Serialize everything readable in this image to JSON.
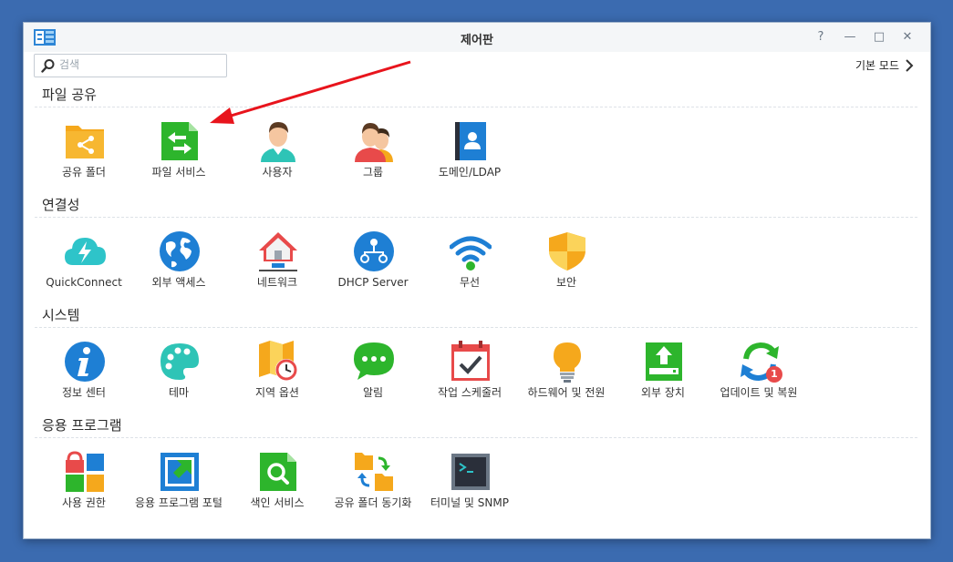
{
  "window": {
    "title": "제어판",
    "controls": {
      "help": "?",
      "minimize": "—",
      "maximize": "□",
      "close": "✕"
    }
  },
  "search": {
    "placeholder": "검색"
  },
  "mode_link": {
    "label": "기본 모드"
  },
  "sections": {
    "file_sharing": {
      "title": "파일 공유",
      "items": [
        "공유 폴더",
        "파일 서비스",
        "사용자",
        "그룹",
        "도메인/LDAP"
      ]
    },
    "connectivity": {
      "title": "연결성",
      "items": [
        "QuickConnect",
        "외부 액세스",
        "네트워크",
        "DHCP Server",
        "무선",
        "보안"
      ]
    },
    "system": {
      "title": "시스템",
      "items": [
        "정보 센터",
        "테마",
        "지역 옵션",
        "알림",
        "작업 스케줄러",
        "하드웨어 및 전원",
        "외부 장치",
        "업데이트 및 복원"
      ]
    },
    "applications": {
      "title": "응용 프로그램",
      "items": [
        "사용 권한",
        "응용 프로그램 포털",
        "색인 서비스",
        "공유 폴더 동기화",
        "터미널 및 SNMP"
      ]
    }
  },
  "badges": {
    "update": "1"
  },
  "colors": {
    "background": "#3b6bb0",
    "arrow": "#e8141c",
    "accent_green": "#2db52c",
    "accent_blue": "#1e7fd4",
    "accent_orange": "#f5a81c"
  }
}
